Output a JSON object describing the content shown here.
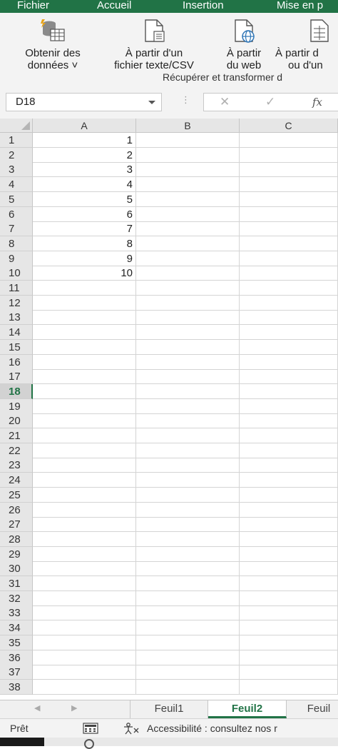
{
  "menu": {
    "tabs": [
      "Fichier",
      "Accueil",
      "Insertion",
      "Mise en p"
    ]
  },
  "ribbon": {
    "buttons": [
      {
        "line1": "Obtenir des",
        "line2": "données ˅",
        "icon": "database-table-icon"
      },
      {
        "line1": "À partir d'un",
        "line2": "fichier texte/CSV",
        "icon": "text-file-icon"
      },
      {
        "line1": "À partir",
        "line2": "du web",
        "icon": "web-file-icon"
      },
      {
        "line1": "À partir d",
        "line2": "ou d'un",
        "icon": "table-file-icon"
      }
    ],
    "group_label": "Récupérer et transformer d"
  },
  "formula_bar": {
    "name_box": "D18",
    "formula": ""
  },
  "grid": {
    "columns": [
      "A",
      "B",
      "C"
    ],
    "rows": [
      {
        "n": "1",
        "a": "1"
      },
      {
        "n": "2",
        "a": "2"
      },
      {
        "n": "3",
        "a": "3"
      },
      {
        "n": "4",
        "a": "4"
      },
      {
        "n": "5",
        "a": "5"
      },
      {
        "n": "6",
        "a": "6"
      },
      {
        "n": "7",
        "a": "7"
      },
      {
        "n": "8",
        "a": "8"
      },
      {
        "n": "9",
        "a": "9"
      },
      {
        "n": "10",
        "a": "10"
      },
      {
        "n": "11",
        "a": ""
      },
      {
        "n": "12",
        "a": ""
      },
      {
        "n": "13",
        "a": ""
      },
      {
        "n": "14",
        "a": ""
      },
      {
        "n": "15",
        "a": ""
      },
      {
        "n": "16",
        "a": ""
      },
      {
        "n": "17",
        "a": ""
      },
      {
        "n": "18",
        "a": ""
      },
      {
        "n": "19",
        "a": ""
      },
      {
        "n": "20",
        "a": ""
      },
      {
        "n": "21",
        "a": ""
      },
      {
        "n": "22",
        "a": ""
      },
      {
        "n": "23",
        "a": ""
      },
      {
        "n": "24",
        "a": ""
      },
      {
        "n": "25",
        "a": ""
      },
      {
        "n": "26",
        "a": ""
      },
      {
        "n": "27",
        "a": ""
      },
      {
        "n": "28",
        "a": ""
      },
      {
        "n": "29",
        "a": ""
      },
      {
        "n": "30",
        "a": ""
      },
      {
        "n": "31",
        "a": ""
      },
      {
        "n": "32",
        "a": ""
      },
      {
        "n": "33",
        "a": ""
      },
      {
        "n": "34",
        "a": ""
      },
      {
        "n": "35",
        "a": ""
      },
      {
        "n": "36",
        "a": ""
      },
      {
        "n": "37",
        "a": ""
      },
      {
        "n": "38",
        "a": ""
      }
    ],
    "active_row": "18"
  },
  "sheets": {
    "tabs": [
      "Feuil1",
      "Feuil2",
      "Feuil"
    ],
    "active": "Feuil2"
  },
  "status": {
    "ready": "Prêt",
    "accessibility": "Accessibilité : consultez nos r"
  },
  "colors": {
    "accent": "#217346"
  }
}
